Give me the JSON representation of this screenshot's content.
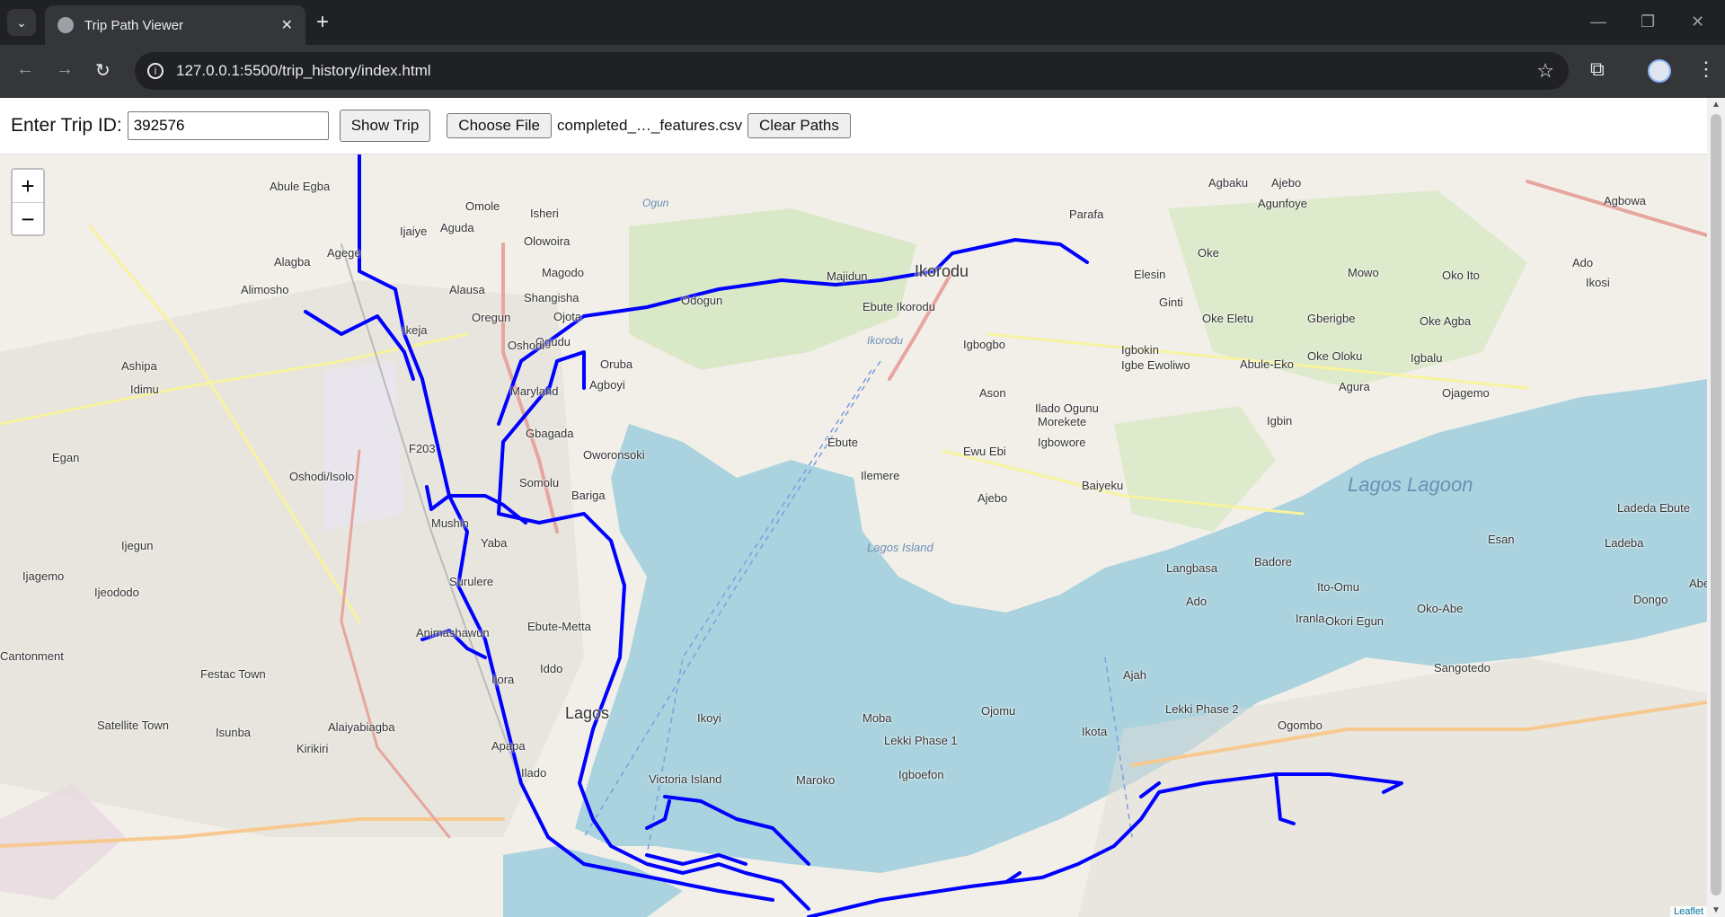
{
  "browser": {
    "tab_title": "Trip Path Viewer",
    "url": "127.0.0.1:5500/trip_history/index.html",
    "tab_close": "✕",
    "new_tab": "+"
  },
  "controls": {
    "trip_label": "Enter Trip ID:",
    "trip_value": "392576",
    "show_button": "Show Trip",
    "choose_button": "Choose File",
    "file_name": "completed_…_features.csv",
    "clear_button": "Clear Paths"
  },
  "map": {
    "zoom_in": "+",
    "zoom_out": "−",
    "attribution": "Leaflet",
    "route_color": "#0000ff",
    "water_color": "#aad3df",
    "land_color": "#f2efe9",
    "places": [
      {
        "name": "Abule Egba"
      },
      {
        "name": "Omole"
      },
      {
        "name": "Isheri"
      },
      {
        "name": "Ijaiye"
      },
      {
        "name": "Aguda"
      },
      {
        "name": "Olowoira"
      },
      {
        "name": "Alagba"
      },
      {
        "name": "Agege"
      },
      {
        "name": "Magodo"
      },
      {
        "name": "Alimosho"
      },
      {
        "name": "Alausa"
      },
      {
        "name": "Shangisha"
      },
      {
        "name": "Ikeja"
      },
      {
        "name": "Oregun"
      },
      {
        "name": "Ojota"
      },
      {
        "name": "Ogudu"
      },
      {
        "name": "Oshodi"
      },
      {
        "name": "Odogun"
      },
      {
        "name": "Majidun"
      },
      {
        "name": "Ikorodu"
      },
      {
        "name": "Ebute Ikorodu"
      },
      {
        "name": "Agbaku"
      },
      {
        "name": "Ajebo"
      },
      {
        "name": "Agunfoye"
      },
      {
        "name": "Parafa"
      },
      {
        "name": "Agbowa"
      },
      {
        "name": "Oke"
      },
      {
        "name": "Elesin"
      },
      {
        "name": "Mowo"
      },
      {
        "name": "Oko Ito"
      },
      {
        "name": "Ikosi"
      },
      {
        "name": "Ado"
      },
      {
        "name": "Ginti"
      },
      {
        "name": "Oke Eletu"
      },
      {
        "name": "Gberigbe"
      },
      {
        "name": "Oke Agba"
      },
      {
        "name": "Igbogbo"
      },
      {
        "name": "Igbokin"
      },
      {
        "name": "Igbe Ewoliwo"
      },
      {
        "name": "Abule-Eko"
      },
      {
        "name": "Oke Oloku"
      },
      {
        "name": "Igbalu"
      },
      {
        "name": "Agura"
      },
      {
        "name": "Ojagemo"
      },
      {
        "name": "Ashipa"
      },
      {
        "name": "Idimu"
      },
      {
        "name": "Maryland"
      },
      {
        "name": "Oruba"
      },
      {
        "name": "Agboyi"
      },
      {
        "name": "Ason"
      },
      {
        "name": "Ilado Ogunu"
      },
      {
        "name": "Morekete"
      },
      {
        "name": "Igbin"
      },
      {
        "name": "Igbowore"
      },
      {
        "name": "Ebute"
      },
      {
        "name": "Ewu Ebi"
      },
      {
        "name": "Gbagada"
      },
      {
        "name": "Oworonsoki"
      },
      {
        "name": "Egan"
      },
      {
        "name": "Oshodi/Isolo"
      },
      {
        "name": "Somolu"
      },
      {
        "name": "Bariga"
      },
      {
        "name": "Ilemere"
      },
      {
        "name": "Ajebo"
      },
      {
        "name": "Baiyeku"
      },
      {
        "name": "Mushin"
      },
      {
        "name": "Ijegun"
      },
      {
        "name": "Yaba"
      },
      {
        "name": "Ladeda Ebute"
      },
      {
        "name": "Ijagemo"
      },
      {
        "name": "Ijeododo"
      },
      {
        "name": "Surulere"
      },
      {
        "name": "Langbasa"
      },
      {
        "name": "Badore"
      },
      {
        "name": "Ito-Omu"
      },
      {
        "name": "Esan"
      },
      {
        "name": "Ladeba"
      },
      {
        "name": "Ado"
      },
      {
        "name": "Abeg"
      },
      {
        "name": "Animashawun"
      },
      {
        "name": "Ebute-Metta"
      },
      {
        "name": "Iranla"
      },
      {
        "name": "Okori Egun"
      },
      {
        "name": "Oko-Abe"
      },
      {
        "name": "Dongo"
      },
      {
        "name": "Cantonment"
      },
      {
        "name": "Festac Town"
      },
      {
        "name": "Ijora"
      },
      {
        "name": "Iddo"
      },
      {
        "name": "Ajah"
      },
      {
        "name": "Sangotedo"
      },
      {
        "name": "Lagos"
      },
      {
        "name": "Ikoyi"
      },
      {
        "name": "Ojomu"
      },
      {
        "name": "Lekki Phase 2"
      },
      {
        "name": "Satellite Town"
      },
      {
        "name": "Isunba"
      },
      {
        "name": "Alaiyabiagba"
      },
      {
        "name": "Apapa"
      },
      {
        "name": "Moba"
      },
      {
        "name": "Ikota"
      },
      {
        "name": "Ogombo"
      },
      {
        "name": "Kirikiri"
      },
      {
        "name": "Lekki Phase 1"
      },
      {
        "name": "Ilado"
      },
      {
        "name": "Victoria Island"
      },
      {
        "name": "Maroko"
      },
      {
        "name": "Igboefon"
      },
      {
        "name": "F203"
      }
    ],
    "water_labels": [
      {
        "name": "Lagos Lagoon"
      },
      {
        "name": "Lagos Island"
      },
      {
        "name": "Ogun"
      },
      {
        "name": "Ikorodu"
      }
    ]
  }
}
